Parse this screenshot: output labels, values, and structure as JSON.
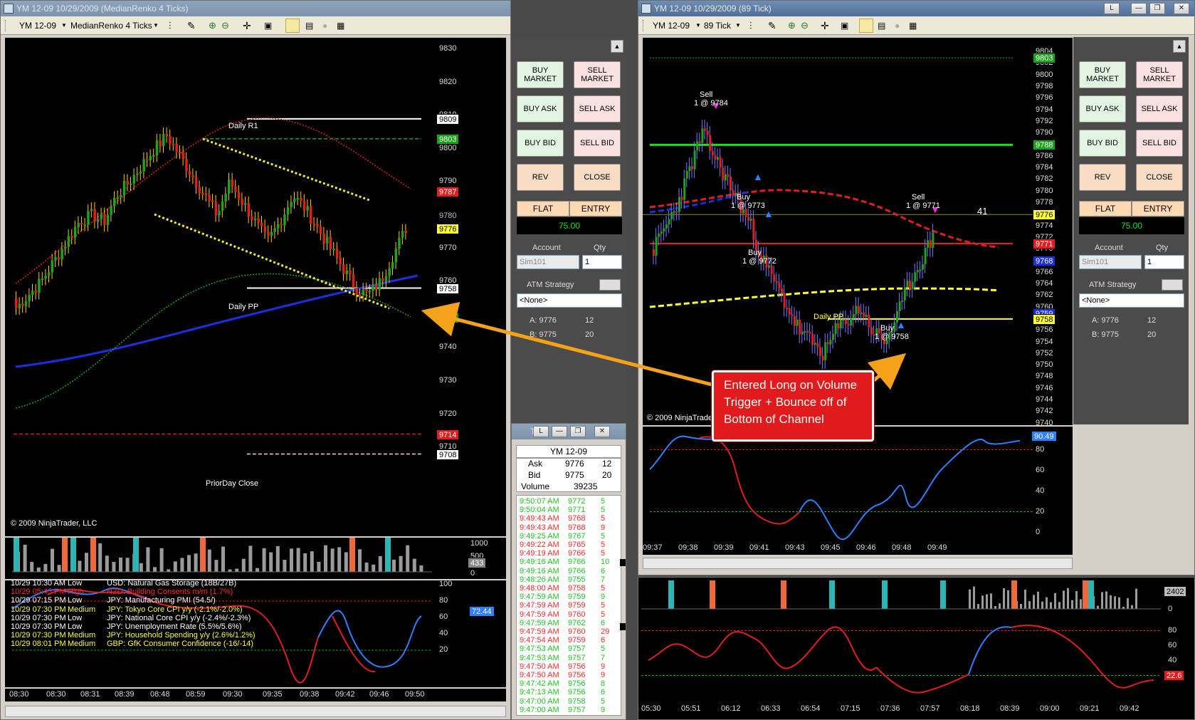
{
  "left_window": {
    "title": "YM 12-09  10/29/2009 (MedianRenko 4 Ticks)",
    "instrument": "YM 12-09",
    "bar_type": "MedianRenko 4 Ticks",
    "copyright": "© 2009 NinjaTrader, LLC",
    "price_ticks": [
      "9830",
      "9820",
      "9810",
      "9800",
      "9790",
      "9780",
      "9770",
      "9760",
      "9750",
      "9740",
      "9730",
      "9720",
      "9710"
    ],
    "price_badges": [
      {
        "text": "9809",
        "bg": "#ffffff",
        "fg": "#000000"
      },
      {
        "text": "9803",
        "bg": "#1aa31a",
        "fg": "#ffffff"
      },
      {
        "text": "9787",
        "bg": "#e01e1e",
        "fg": "#ffffff"
      },
      {
        "text": "9780",
        "bg": "#000000",
        "fg": "#bbbbbb"
      },
      {
        "text": "9776",
        "bg": "#ffff33",
        "fg": "#000000"
      },
      {
        "text": "9758",
        "bg": "#ffffff",
        "fg": "#000000"
      },
      {
        "text": "9749",
        "bg": "#1aa31a",
        "fg": "#ffffff"
      },
      {
        "text": "9714",
        "bg": "#e01e1e",
        "fg": "#ffffff"
      },
      {
        "text": "9708",
        "bg": "#ffffff",
        "fg": "#000000"
      }
    ],
    "line_labels": {
      "daily_r1": "Daily R1",
      "daily_pp": "Daily PP",
      "prior_close": "PriorDay Close"
    },
    "volume_ticks": [
      "1000",
      "500",
      "0"
    ],
    "volume_badge": "433",
    "osc_ticks": [
      "100",
      "80",
      "60",
      "40",
      "20"
    ],
    "osc_badge": "72.44",
    "time_ticks": [
      "08:30",
      "08:30",
      "08:31",
      "08:39",
      "08:48",
      "08:59",
      "09:30",
      "09:35",
      "09:38",
      "09:42",
      "09:46",
      "09:50"
    ],
    "news": [
      {
        "date": "10/29 10:30 AM",
        "impact": "Low",
        "event": "USD: Natural Gas Storage (18B/27B)",
        "color": "#ffffff"
      },
      {
        "date": "10/29 05:45 PM",
        "impact": "High",
        "event": "NZD: Building Consents m/m (1.7%)",
        "color": "#ff2a2a"
      },
      {
        "date": "10/29 07:15 PM",
        "impact": "Low",
        "event": "JPY: Manufacturing PMI (54.5/)",
        "color": "#ffffff"
      },
      {
        "date": "10/29 07:30 PM",
        "impact": "Medium",
        "event": "JPY: Tokyo Core CPI y/y (-2.1%/-2.0%)",
        "color": "#ffff33"
      },
      {
        "date": "10/29 07:30 PM",
        "impact": "Low",
        "event": "JPY: National Core CPI y/y (-2.4%/-2.3%)",
        "color": "#ffffff"
      },
      {
        "date": "10/29 07:30 PM",
        "impact": "Low",
        "event": "JPY: Unemployment Rate (5.5%/5.6%)",
        "color": "#ffffff"
      },
      {
        "date": "10/29 07:30 PM",
        "impact": "Medium",
        "event": "JPY: Household Spending y/y (2.6%/1.2%)",
        "color": "#ffff33"
      },
      {
        "date": "10/29 08:01 PM",
        "impact": "Medium",
        "event": "GBP: GfK Consumer Confidence (-16/-14)",
        "color": "#ffff33"
      }
    ]
  },
  "right_window": {
    "title": "YM 12-09  10/29/2009 (89 Tick)",
    "instrument": "YM 12-09",
    "bar_type": "89 Tick",
    "copyright": "© 2009 NinjaTrader, LLC",
    "price_ticks": [
      "9804",
      "9802",
      "9800",
      "9798",
      "9796",
      "9794",
      "9792",
      "9790",
      "9788",
      "9786",
      "9784",
      "9782",
      "9780",
      "9778",
      "9776",
      "9774",
      "9772",
      "9770",
      "9768",
      "9766",
      "9764",
      "9762",
      "9760",
      "9758",
      "9756",
      "9754",
      "9752",
      "9750",
      "9748",
      "9746",
      "9744",
      "9742",
      "9740"
    ],
    "price_badges": [
      {
        "text": "9803",
        "bg": "#1aa31a",
        "fg": "#ffffff"
      },
      {
        "text": "9788",
        "bg": "#1aa31a",
        "fg": "#ffffff"
      },
      {
        "text": "9776",
        "bg": "#ffff33",
        "fg": "#000000"
      },
      {
        "text": "9771",
        "bg": "#e01e1e",
        "fg": "#ffffff"
      },
      {
        "text": "9768",
        "bg": "#1b2fe0",
        "fg": "#ffffff"
      },
      {
        "text": "9759",
        "bg": "#1b2fe0",
        "fg": "#ffffff"
      },
      {
        "text": "9758",
        "bg": "#ffff33",
        "fg": "#000000"
      }
    ],
    "daily_pp": "Daily PP",
    "bar_count": "41",
    "trades": [
      {
        "side": "Sell",
        "fill": "1 @ 9784"
      },
      {
        "side": "Buy",
        "fill": "1 @ 9773"
      },
      {
        "side": "Buy",
        "fill": "1 @ 9772"
      },
      {
        "side": "Sell",
        "fill": "1 @ 9771"
      },
      {
        "side": "Buy",
        "fill": "1 @ 9758"
      }
    ],
    "osc_ticks": [
      "80",
      "60",
      "40",
      "20",
      "0"
    ],
    "osc_badge": "90.49",
    "time_ticks": [
      "09:37",
      "09:38",
      "09:39",
      "09:41",
      "09:43",
      "09:45",
      "09:46",
      "09:48",
      "09:49"
    ]
  },
  "bottom_right": {
    "volume_ticks": [
      "2402",
      "0"
    ],
    "osc_ticks": [
      "80",
      "60",
      "40",
      "20"
    ],
    "osc_badge": "22.6",
    "time_ticks": [
      "05:30",
      "05:51",
      "06:12",
      "06:33",
      "06:54",
      "07:15",
      "07:36",
      "07:57",
      "08:18",
      "08:39",
      "09:00",
      "09:21",
      "09:42"
    ]
  },
  "chart_trader": {
    "buy_market": "BUY\nMARKET",
    "sell_market": "SELL\nMARKET",
    "buy_ask": "BUY ASK",
    "sell_ask": "SELL ASK",
    "buy_bid": "BUY BID",
    "sell_bid": "SELL BID",
    "rev": "REV",
    "close": "CLOSE",
    "flat": "FLAT",
    "entry": "ENTRY",
    "pnl": "75.00",
    "account_label": "Account",
    "qty_label": "Qty",
    "account_value": "Sim101",
    "qty_value": "1",
    "atm_label": "ATM Strategy",
    "atm_value": "<None>",
    "ask_line": "A: 9776",
    "ask_size": "12",
    "bid_line": "B: 9775",
    "bid_size": "20"
  },
  "time_sales": {
    "title": "T",
    "instrument": "YM 12-09",
    "ask_label": "Ask",
    "ask_price": "9776",
    "ask_size": "12",
    "bid_label": "Bid",
    "bid_price": "9775",
    "bid_size": "20",
    "volume_label": "Volume",
    "volume": "39235",
    "rows": [
      {
        "t": "9:50:07 AM",
        "p": "9772",
        "s": "5",
        "c": "#22c522"
      },
      {
        "t": "9:50:04 AM",
        "p": "9771",
        "s": "5",
        "c": "#22c522"
      },
      {
        "t": "9:49:43 AM",
        "p": "9768",
        "s": "5",
        "c": "#ff2a2a"
      },
      {
        "t": "9:49:43 AM",
        "p": "9768",
        "s": "9",
        "c": "#ff2a2a"
      },
      {
        "t": "9:49:25 AM",
        "p": "9767",
        "s": "5",
        "c": "#22c522"
      },
      {
        "t": "9:49:22 AM",
        "p": "9765",
        "s": "5",
        "c": "#ff2a2a"
      },
      {
        "t": "9:49:19 AM",
        "p": "9766",
        "s": "5",
        "c": "#ff2a2a"
      },
      {
        "t": "9:49:16 AM",
        "p": "9766",
        "s": "10",
        "c": "#22c522"
      },
      {
        "t": "9:49:16 AM",
        "p": "9766",
        "s": "6",
        "c": "#22c522"
      },
      {
        "t": "9:48:26 AM",
        "p": "9755",
        "s": "7",
        "c": "#22c522"
      },
      {
        "t": "9:48:00 AM",
        "p": "9758",
        "s": "5",
        "c": "#ff2a2a"
      },
      {
        "t": "9:47:59 AM",
        "p": "9759",
        "s": "9",
        "c": "#22c522"
      },
      {
        "t": "9:47:59 AM",
        "p": "9759",
        "s": "5",
        "c": "#ff2a2a"
      },
      {
        "t": "9:47:59 AM",
        "p": "9760",
        "s": "5",
        "c": "#ff2a2a"
      },
      {
        "t": "9:47:59 AM",
        "p": "9762",
        "s": "6",
        "c": "#22c522"
      },
      {
        "t": "9:47:59 AM",
        "p": "9760",
        "s": "29",
        "c": "#ff2a2a"
      },
      {
        "t": "9:47:54 AM",
        "p": "9759",
        "s": "6",
        "c": "#ff2a2a"
      },
      {
        "t": "9:47:53 AM",
        "p": "9757",
        "s": "5",
        "c": "#22c522"
      },
      {
        "t": "9:47:53 AM",
        "p": "9757",
        "s": "7",
        "c": "#22c522"
      },
      {
        "t": "9:47:50 AM",
        "p": "9756",
        "s": "9",
        "c": "#ff2a2a"
      },
      {
        "t": "9:47:50 AM",
        "p": "9756",
        "s": "9",
        "c": "#ff2a2a"
      },
      {
        "t": "9:47:42 AM",
        "p": "9756",
        "s": "8",
        "c": "#22c522"
      },
      {
        "t": "9:47:13 AM",
        "p": "9756",
        "s": "6",
        "c": "#22c522"
      },
      {
        "t": "9:47:00 AM",
        "p": "9758",
        "s": "5",
        "c": "#22c522"
      },
      {
        "t": "9:47:00 AM",
        "p": "9757",
        "s": "9",
        "c": "#22c522"
      }
    ]
  },
  "annotation": {
    "line1": "Entered Long on Volume",
    "line2": "Trigger + Bounce off of",
    "line3": "Bottom of Channel"
  }
}
